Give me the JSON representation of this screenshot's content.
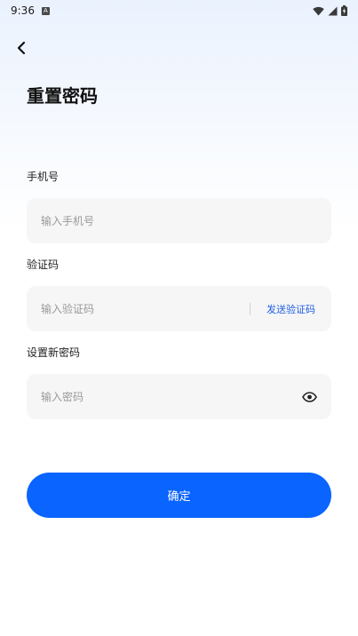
{
  "status_bar": {
    "time": "9:36",
    "app_icon_letter": "A",
    "icons": [
      "wifi-icon",
      "signal-icon",
      "battery-charging-icon"
    ]
  },
  "header": {
    "back_icon": "chevron-left-icon",
    "title": "重置密码"
  },
  "form": {
    "phone": {
      "label": "手机号",
      "placeholder": "输入手机号",
      "value": ""
    },
    "code": {
      "label": "验证码",
      "placeholder": "输入验证码",
      "value": "",
      "send_label": "发送验证码"
    },
    "password": {
      "label": "设置新密码",
      "placeholder": "输入密码",
      "value": "",
      "toggle_icon": "eye-icon"
    },
    "submit_label": "确定"
  },
  "colors": {
    "primary": "#0a64ff",
    "link": "#1f5fe0",
    "input_bg": "#f6f6f7",
    "header_gradient_top": "#eaf2fe"
  }
}
